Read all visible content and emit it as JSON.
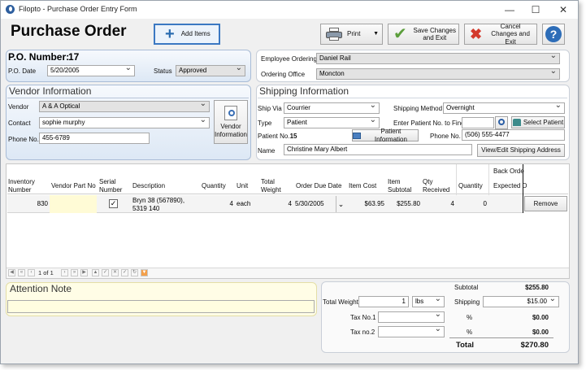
{
  "window": {
    "title": "Filopto - Purchase Order Entry Form",
    "minimize": "—",
    "maximize": "☐",
    "close": "✕"
  },
  "header": {
    "title": "Purchase Order",
    "add_items": "Add Items",
    "print": "Print",
    "save": "Save Changes and Exit",
    "cancel": "Cancel Changes and Exit",
    "help": "?"
  },
  "po": {
    "number_label": "P.O. Number:",
    "number": "17",
    "date_label": "P.O. Date",
    "date": "5/20/2005",
    "status_label": "Status",
    "status": "Approved"
  },
  "employee": {
    "ordering_label": "Employee Ordering",
    "ordering": "Daniel Rail",
    "office_label": "Ordering Office",
    "office": "Moncton"
  },
  "vendor": {
    "title": "Vendor Information",
    "vendor_label": "Vendor",
    "vendor": "A & A Optical",
    "contact_label": "Contact",
    "contact": "sophie murphy",
    "phone_label": "Phone No.",
    "phone": "455-6789",
    "info_button": "Vendor Information"
  },
  "shipping": {
    "title": "Shipping Information",
    "ship_via_label": "Ship Via",
    "ship_via": "Courrier",
    "method_label": "Shipping Method",
    "method": "Overnight",
    "type_label": "Type",
    "type": "Patient",
    "find_label": "Enter Patient No. to Find",
    "find_value": "",
    "select_patient": "Select Patient",
    "patient_no_label": "Patient No.",
    "patient_no": "15",
    "patient_info": "Patient Information",
    "phone_label": "Phone No.",
    "phone": "(506) 555-4477",
    "name_label": "Name",
    "name": "Christine Mary Albert",
    "view_edit": "View/Edit Shipping Address"
  },
  "grid": {
    "group_header": "Back Orde",
    "columns": [
      "Inventory Number",
      "Vendor Part No",
      "Serial Number",
      "Description",
      "Quantity",
      "Unit",
      "Total Weight",
      "Order Due Date",
      "Item Cost",
      "Item Subtotal",
      "Qty Received",
      "Quantity",
      "Expected D"
    ],
    "row": {
      "inventory": "830",
      "vendor_part": "",
      "serial": "✓",
      "description": "Bryn 38 (567890), 5319 140",
      "quantity": "4",
      "unit": "each",
      "weight": "4",
      "due_date": "5/30/2005",
      "cost": "$63.95",
      "subtotal": "$255.80",
      "received": "4",
      "bo_quantity": "0",
      "remove": "Remove"
    },
    "pager": "1 of 1"
  },
  "attention": {
    "title": "Attention Note",
    "value": ""
  },
  "totals": {
    "weight_label": "Total Weight",
    "weight": "1",
    "weight_unit": "lbs",
    "subtotal_label": "Subtotal",
    "subtotal": "$255.80",
    "shipping_label": "Shipping",
    "shipping": "$15.00",
    "tax1_label": "Tax No.1",
    "tax1_value": "",
    "tax1_pct": "%",
    "tax1_amount": "$0.00",
    "tax2_label": "Tax no.2",
    "tax2_value": "",
    "tax2_pct": "%",
    "tax2_amount": "$0.00",
    "total_label": "Total",
    "total": "$270.80"
  },
  "colors": {
    "accent_blue": "#2b6cb0",
    "panel_blue": "#dde8f5",
    "note_yellow": "#fffde0"
  }
}
